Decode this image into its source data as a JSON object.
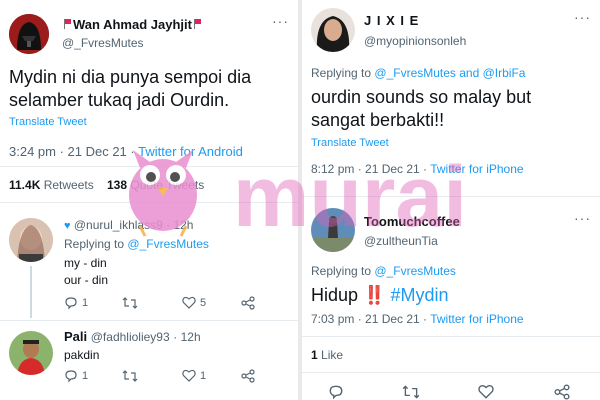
{
  "left": {
    "tweet": {
      "name": "Wan Ahmad Jayhjit",
      "handle": "@_FvresMutes",
      "text": "Mydin ni dia punya sempoi dia selamber tukaq jadi Ourdin.",
      "translate": "Translate Tweet",
      "time": "3:24 pm · 21 Dec 21 ·",
      "source": "Twitter for Android",
      "retweets_count": "11.4K",
      "retweets_label": "Retweets",
      "quotes_count": "138",
      "quotes_label": "Quote Tweets"
    },
    "replies": [
      {
        "name": "@nurul_ikhlass9",
        "time": "· 12h",
        "replying_prefix": "Replying to",
        "replying_handle": "@_FvresMutes",
        "line1": "my - din",
        "line2": "our - din",
        "reply_count": "1",
        "like_count": "5"
      },
      {
        "name": "Pali",
        "handle": "@fadhlioliey93",
        "time": "· 12h",
        "text": "pakdin",
        "reply_count": "1",
        "like_count": "1"
      }
    ]
  },
  "right": {
    "tweet1": {
      "name": "J I X I E",
      "handle": "@myopinionsonleh",
      "replying_prefix": "Replying to",
      "replying_handles": "@_FvresMutes and @IrbiFa",
      "text": "ourdin sounds so malay but sangat berbakti!!",
      "translate": "Translate Tweet",
      "time": "8:12 pm · 21 Dec 21 ·",
      "source": "Twitter for iPhone"
    },
    "tweet2": {
      "name": "Toomuchcoffee",
      "handle": "@zultheunTia",
      "replying_prefix": "Replying to",
      "replying_handle": "@_FvresMutes",
      "text_plain": "Hidup",
      "text_emoji": "‼️",
      "hashtag": "#Mydin",
      "time": "7:03 pm · 21 Dec 21 ·",
      "source": "Twitter for iPhone",
      "likes_count": "1",
      "likes_label": "Like"
    }
  },
  "watermark": {
    "text": "murai",
    "color": "#e060b8"
  },
  "icons": {
    "reply": "reply-icon",
    "retweet": "retweet-icon",
    "like": "heart-icon",
    "share": "share-icon",
    "more": "more-icon"
  },
  "colors": {
    "link": "#1d9bf0",
    "muted": "#536471",
    "text": "#0f1419",
    "watermark": "#e060b8"
  }
}
